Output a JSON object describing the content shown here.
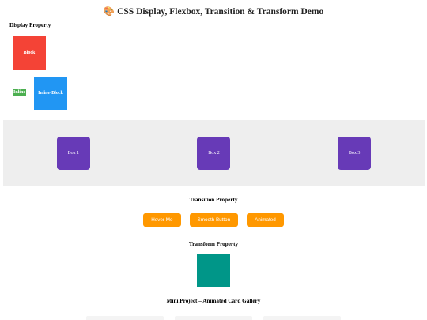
{
  "page": {
    "title_icon": "palette-icon",
    "title": "CSS Display, Flexbox, Transition & Transform Demo"
  },
  "display_section": {
    "heading": "Display Property",
    "block_label": "Block",
    "inline_label": "Inline",
    "inline_block_label": "Inline-Block",
    "colors": {
      "block": "#f44336",
      "inline": "#4caf50",
      "inline_block": "#2196f3"
    }
  },
  "flex_section": {
    "boxes": [
      "Box 1",
      "Box 2",
      "Box 3"
    ],
    "colors": {
      "container": "#eeeeee",
      "box": "#673ab7"
    }
  },
  "transition_section": {
    "heading": "Transition Property",
    "buttons": [
      "Hover Me",
      "Smooth Button",
      "Animated"
    ],
    "button_color": "#ff9800"
  },
  "transform_section": {
    "heading": "Transform Property",
    "box_color": "#009688"
  },
  "gallery_section": {
    "heading": "Mini Project – Animated Card Gallery"
  }
}
